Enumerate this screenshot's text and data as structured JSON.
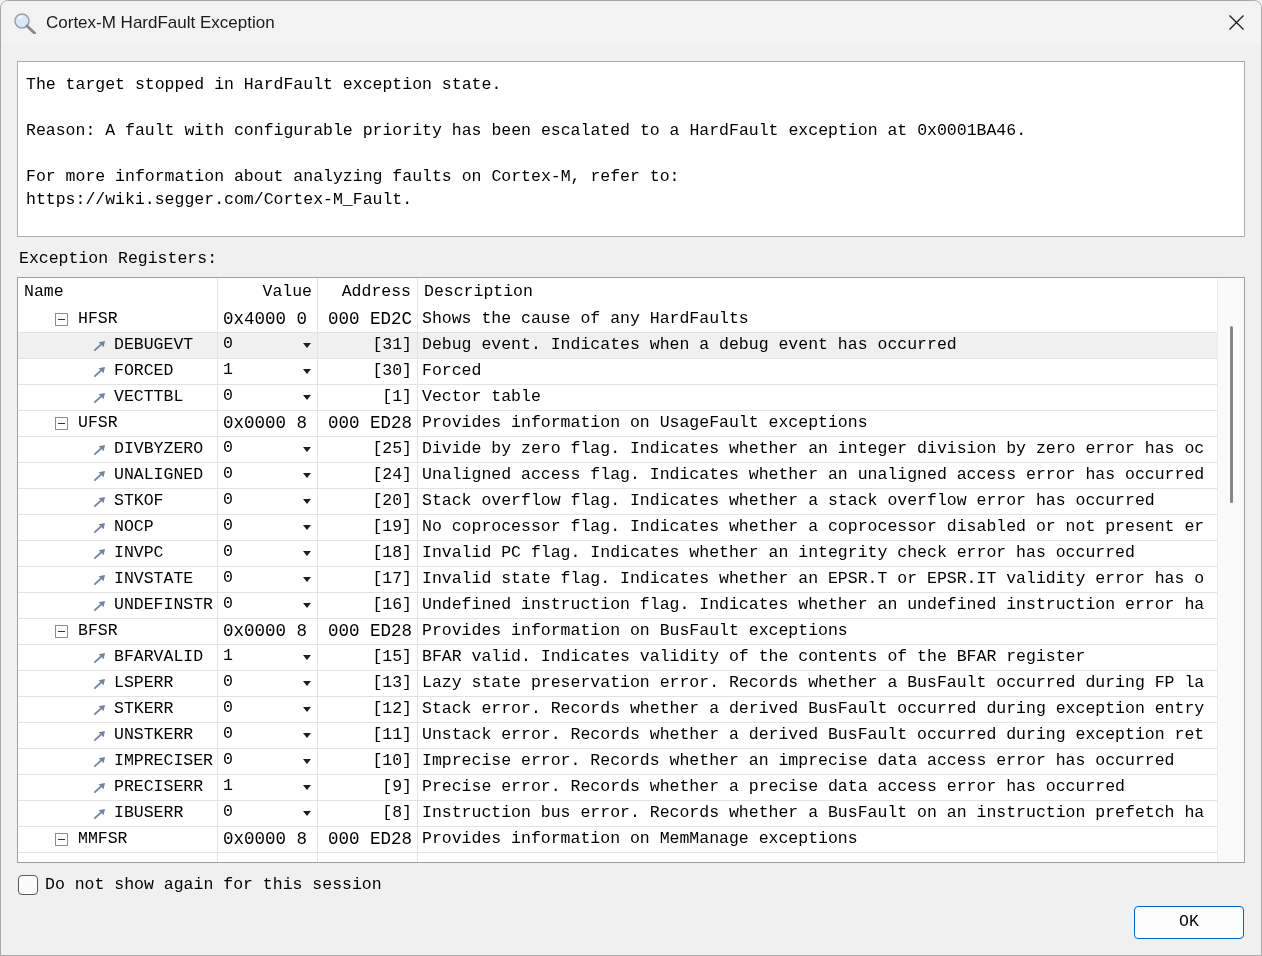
{
  "window": {
    "title": "Cortex-M HardFault Exception"
  },
  "message": {
    "paragraphs": [
      "The target stopped in HardFault exception state.",
      "Reason: A fault with configurable priority has been escalated to a HardFault exception at 0x0001BA46.",
      "For more information about analyzing faults on Cortex-M, refer to:\nhttps://wiki.segger.com/Cortex-M_Fault."
    ]
  },
  "registers": {
    "label": "Exception Registers:",
    "columns": [
      "Name",
      "Value",
      "Address",
      "Description"
    ],
    "rows": [
      {
        "name": "HFSR",
        "value": "0x4000 0",
        "address": "000 ED2C",
        "description": "Shows the cause of any HardFaults",
        "expanded": true,
        "selected": false,
        "children": [
          {
            "name": "DEBUGEVT",
            "value": "0",
            "address": "[31]",
            "description": "Debug event. Indicates when a debug event has occurred",
            "selected": true
          },
          {
            "name": "FORCED",
            "value": "1",
            "address": "[30]",
            "description": "Forced",
            "selected": false
          },
          {
            "name": "VECTTBL",
            "value": "0",
            "address": "[1]",
            "description": "Vector table",
            "selected": false
          }
        ]
      },
      {
        "name": "UFSR",
        "value": "0x0000 8",
        "address": "000 ED28",
        "description": "Provides information on UsageFault exceptions",
        "expanded": true,
        "selected": false,
        "children": [
          {
            "name": "DIVBYZERO",
            "value": "0",
            "address": "[25]",
            "description": "Divide by zero flag. Indicates whether an integer division by zero error has oc",
            "selected": false
          },
          {
            "name": "UNALIGNED",
            "value": "0",
            "address": "[24]",
            "description": "Unaligned access flag. Indicates whether an unaligned access error has occurred",
            "selected": false
          },
          {
            "name": "STKOF",
            "value": "0",
            "address": "[20]",
            "description": "Stack overflow flag. Indicates whether a stack overflow error has occurred",
            "selected": false
          },
          {
            "name": "NOCP",
            "value": "0",
            "address": "[19]",
            "description": "No coprocessor flag. Indicates whether a coprocessor disabled or not present er",
            "selected": false
          },
          {
            "name": "INVPC",
            "value": "0",
            "address": "[18]",
            "description": "Invalid PC flag. Indicates whether an integrity check error has occurred",
            "selected": false
          },
          {
            "name": "INVSTATE",
            "value": "0",
            "address": "[17]",
            "description": "Invalid state flag. Indicates whether an EPSR.T or EPSR.IT validity error has o",
            "selected": false
          },
          {
            "name": "UNDEFINSTR",
            "value": "0",
            "address": "[16]",
            "description": "Undefined instruction flag. Indicates whether an undefined instruction error ha",
            "selected": false
          }
        ]
      },
      {
        "name": "BFSR",
        "value": "0x0000 8",
        "address": "000 ED28",
        "description": "Provides information on BusFault exceptions",
        "expanded": true,
        "selected": false,
        "children": [
          {
            "name": "BFARVALID",
            "value": "1",
            "address": "[15]",
            "description": "BFAR valid. Indicates validity of the contents of the BFAR register",
            "selected": false
          },
          {
            "name": "LSPERR",
            "value": "0",
            "address": "[13]",
            "description": "Lazy state preservation error. Records whether a BusFault occurred during FP la",
            "selected": false
          },
          {
            "name": "STKERR",
            "value": "0",
            "address": "[12]",
            "description": "Stack error. Records whether a derived BusFault occurred during exception entry",
            "selected": false
          },
          {
            "name": "UNSTKERR",
            "value": "0",
            "address": "[11]",
            "description": "Unstack error. Records whether a derived BusFault occurred during exception ret",
            "selected": false
          },
          {
            "name": "IMPRECISER",
            "value": "0",
            "address": "[10]",
            "description": "Imprecise error. Records whether an imprecise data access error has occurred",
            "selected": false
          },
          {
            "name": "PRECISERR",
            "value": "1",
            "address": "[9]",
            "description": "Precise error. Records whether a precise data access error has occurred",
            "selected": false
          },
          {
            "name": "IBUSERR",
            "value": "0",
            "address": "[8]",
            "description": "Instruction bus error. Records whether a BusFault on an instruction prefetch ha",
            "selected": false
          }
        ]
      },
      {
        "name": "MMFSR",
        "value": "0x0000 8",
        "address": "000 ED28",
        "description": "Provides information on MemManage exceptions",
        "expanded": true,
        "selected": false
      }
    ]
  },
  "dont_show_again": {
    "label": "Do not show again for this session",
    "checked": false
  },
  "buttons": [
    "OK"
  ]
}
